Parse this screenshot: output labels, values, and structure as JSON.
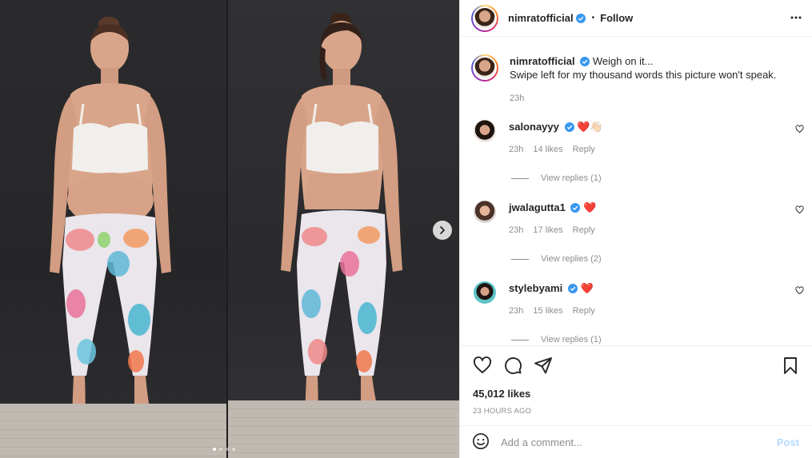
{
  "post": {
    "author": "nimratofficial",
    "follow_label": "Follow",
    "bullet": "•",
    "caption_line1": "Weigh on it...",
    "caption_line2": "Swipe left for my thousand words this picture won't speak.",
    "caption_time": "23h",
    "likes": "45,012 likes",
    "posted_ago": "23 HOURS AGO",
    "add_comment_placeholder": "Add a comment...",
    "post_label": "Post",
    "carousel_dots": 4,
    "carousel_active_index": 0
  },
  "comments": [
    {
      "user": "salonayyy",
      "emoji": "❤️👋🏻",
      "time": "23h",
      "likes": "14 likes",
      "reply_label": "Reply",
      "view_replies": "View replies (1)"
    },
    {
      "user": "jwalagutta1",
      "emoji": "❤️",
      "time": "23h",
      "likes": "17 likes",
      "reply_label": "Reply",
      "view_replies": "View replies (2)"
    },
    {
      "user": "stylebyami",
      "emoji": "❤️",
      "time": "23h",
      "likes": "15 likes",
      "reply_label": "Reply",
      "view_replies": "View replies (1)"
    }
  ],
  "icons": {
    "more": "more-options-icon",
    "heart": "heart-icon",
    "comment": "comment-icon",
    "share": "share-icon",
    "bookmark": "bookmark-icon",
    "emoji": "emoji-icon",
    "next": "chevron-right-icon",
    "verified": "verified-badge-icon"
  },
  "colors": {
    "verified": "#3897f0",
    "post_disabled": "#b3dbff",
    "muted_text": "#8e8e8e",
    "heart_emoji": "#d1101f"
  }
}
